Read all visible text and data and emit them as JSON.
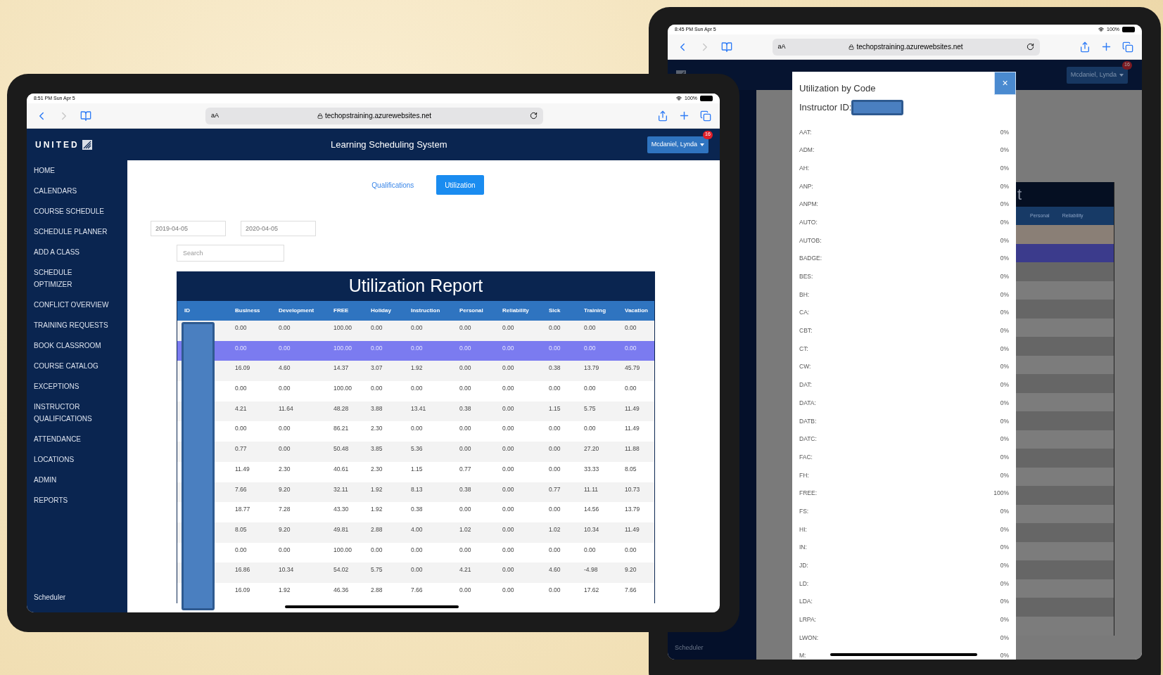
{
  "left_tablet": {
    "status_bar": {
      "time": "8:51 PM  Sun Apr 5",
      "battery": "100%"
    },
    "browser": {
      "text_size": "aA",
      "url": "techopstraining.azurewebsites.net"
    },
    "header": {
      "logo": "UNITED",
      "title": "Learning Scheduling System",
      "user": "Mcdaniel, Lynda",
      "notification_count": "16"
    },
    "sidebar": {
      "items": [
        "HOME",
        "CALENDARS",
        "COURSE SCHEDULE",
        "SCHEDULE PLANNER",
        "ADD A CLASS",
        "SCHEDULE\nOPTIMIZER",
        "CONFLICT OVERVIEW",
        "TRAINING REQUESTS",
        "BOOK CLASSROOM",
        "COURSE CATALOG",
        "EXCEPTIONS",
        "INSTRUCTOR\nQUALIFICATIONS",
        "ATTENDANCE",
        "LOCATIONS",
        "ADMIN",
        "REPORTS"
      ],
      "footer": "Scheduler"
    },
    "tabs": [
      {
        "label": "Qualifications",
        "selected": false
      },
      {
        "label": "Utilization",
        "selected": true
      }
    ],
    "date_from": "2019-04-05",
    "date_to": "2020-04-05",
    "search": {
      "placeholder": "Search"
    },
    "report": {
      "title": "Utilization Report",
      "columns": [
        "ID",
        "Business",
        "Development",
        "FREE",
        "Holiday",
        "Instruction",
        "Personal",
        "Reliability",
        "Sick",
        "Training",
        "Vacation"
      ],
      "rows": [
        {
          "selected": false,
          "values": [
            "0.00",
            "0.00",
            "100.00",
            "0.00",
            "0.00",
            "0.00",
            "0.00",
            "0.00",
            "0.00",
            "0.00"
          ]
        },
        {
          "selected": true,
          "values": [
            "0.00",
            "0.00",
            "100.00",
            "0.00",
            "0.00",
            "0.00",
            "0.00",
            "0.00",
            "0.00",
            "0.00"
          ]
        },
        {
          "selected": false,
          "values": [
            "16.09",
            "4.60",
            "14.37",
            "3.07",
            "1.92",
            "0.00",
            "0.00",
            "0.38",
            "13.79",
            "45.79"
          ]
        },
        {
          "selected": false,
          "values": [
            "0.00",
            "0.00",
            "100.00",
            "0.00",
            "0.00",
            "0.00",
            "0.00",
            "0.00",
            "0.00",
            "0.00"
          ]
        },
        {
          "selected": false,
          "values": [
            "4.21",
            "11.64",
            "48.28",
            "3.88",
            "13.41",
            "0.38",
            "0.00",
            "1.15",
            "5.75",
            "11.49"
          ]
        },
        {
          "selected": false,
          "values": [
            "0.00",
            "0.00",
            "86.21",
            "2.30",
            "0.00",
            "0.00",
            "0.00",
            "0.00",
            "0.00",
            "11.49"
          ]
        },
        {
          "selected": false,
          "values": [
            "0.77",
            "0.00",
            "50.48",
            "3.85",
            "5.36",
            "0.00",
            "0.00",
            "0.00",
            "27.20",
            "11.88"
          ]
        },
        {
          "selected": false,
          "values": [
            "11.49",
            "2.30",
            "40.61",
            "2.30",
            "1.15",
            "0.77",
            "0.00",
            "0.00",
            "33.33",
            "8.05"
          ]
        },
        {
          "selected": false,
          "values": [
            "7.66",
            "9.20",
            "32.11",
            "1.92",
            "8.13",
            "0.38",
            "0.00",
            "0.77",
            "11.11",
            "10.73"
          ]
        },
        {
          "selected": false,
          "values": [
            "18.77",
            "7.28",
            "43.30",
            "1.92",
            "0.38",
            "0.00",
            "0.00",
            "0.00",
            "14.56",
            "13.79"
          ]
        },
        {
          "selected": false,
          "values": [
            "8.05",
            "9.20",
            "49.81",
            "2.88",
            "4.00",
            "1.02",
            "0.00",
            "1.02",
            "10.34",
            "11.49"
          ]
        },
        {
          "selected": false,
          "values": [
            "0.00",
            "0.00",
            "100.00",
            "0.00",
            "0.00",
            "0.00",
            "0.00",
            "0.00",
            "0.00",
            "0.00"
          ]
        },
        {
          "selected": false,
          "values": [
            "16.86",
            "10.34",
            "54.02",
            "5.75",
            "0.00",
            "4.21",
            "0.00",
            "4.60",
            "-4.98",
            "9.20"
          ]
        },
        {
          "selected": false,
          "values": [
            "16.09",
            "1.92",
            "46.36",
            "2.88",
            "7.66",
            "0.00",
            "0.00",
            "0.00",
            "17.62",
            "7.66"
          ]
        }
      ]
    }
  },
  "right_tablet": {
    "status_bar": {
      "time": "8:45 PM  Sun Apr 5",
      "battery": "100%"
    },
    "browser": {
      "text_size": "aA",
      "url": "techopstraining.azurewebsites.net"
    },
    "header": {
      "user": "Mcdaniel, Lynda",
      "notification_count": "16"
    },
    "sidebar": {
      "footer": "Scheduler"
    },
    "background_report": {
      "title_fragment": "t",
      "columns": [
        "Personal",
        "Reliability"
      ]
    },
    "modal": {
      "title": "Utilization by Code",
      "instructor_label": "Instructor ID:",
      "close": "×",
      "codes": [
        {
          "code": "AAT:",
          "value": "0%"
        },
        {
          "code": "ADM:",
          "value": "0%"
        },
        {
          "code": "AH:",
          "value": "0%"
        },
        {
          "code": "ANP:",
          "value": "0%"
        },
        {
          "code": "ANPM:",
          "value": "0%"
        },
        {
          "code": "AUTO:",
          "value": "0%"
        },
        {
          "code": "AUTOB:",
          "value": "0%"
        },
        {
          "code": "BADGE:",
          "value": "0%"
        },
        {
          "code": "BES:",
          "value": "0%"
        },
        {
          "code": "BH:",
          "value": "0%"
        },
        {
          "code": "CA:",
          "value": "0%"
        },
        {
          "code": "CBT:",
          "value": "0%"
        },
        {
          "code": "CT:",
          "value": "0%"
        },
        {
          "code": "CW:",
          "value": "0%"
        },
        {
          "code": "DAT:",
          "value": "0%"
        },
        {
          "code": "DATA:",
          "value": "0%"
        },
        {
          "code": "DATB:",
          "value": "0%"
        },
        {
          "code": "DATC:",
          "value": "0%"
        },
        {
          "code": "FAC:",
          "value": "0%"
        },
        {
          "code": "FH:",
          "value": "0%"
        },
        {
          "code": "FREE:",
          "value": "100%"
        },
        {
          "code": "FS:",
          "value": "0%"
        },
        {
          "code": "HI:",
          "value": "0%"
        },
        {
          "code": "IN:",
          "value": "0%"
        },
        {
          "code": "JD:",
          "value": "0%"
        },
        {
          "code": "LD:",
          "value": "0%"
        },
        {
          "code": "LDA:",
          "value": "0%"
        },
        {
          "code": "LRPA:",
          "value": "0%"
        },
        {
          "code": "LWON:",
          "value": "0%"
        },
        {
          "code": "M:",
          "value": "0%"
        }
      ]
    }
  }
}
